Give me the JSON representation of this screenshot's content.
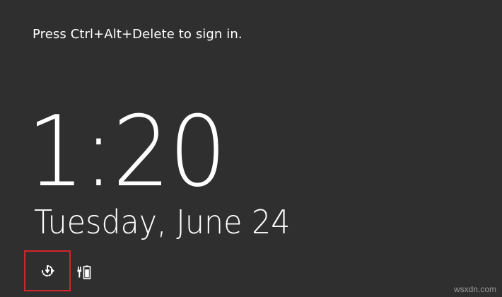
{
  "lock_screen": {
    "prompt": "Press Ctrl+Alt+Delete to sign in.",
    "time": "1:20",
    "date": "Tuesday, June 24"
  },
  "status_icons": {
    "network_icon": "network-connection-icon",
    "battery_icon": "battery-charging-icon"
  },
  "watermark": "wsxdn.com",
  "colors": {
    "background": "#2f2f2f",
    "text": "#ffffff",
    "highlight_border": "#d0272b"
  }
}
